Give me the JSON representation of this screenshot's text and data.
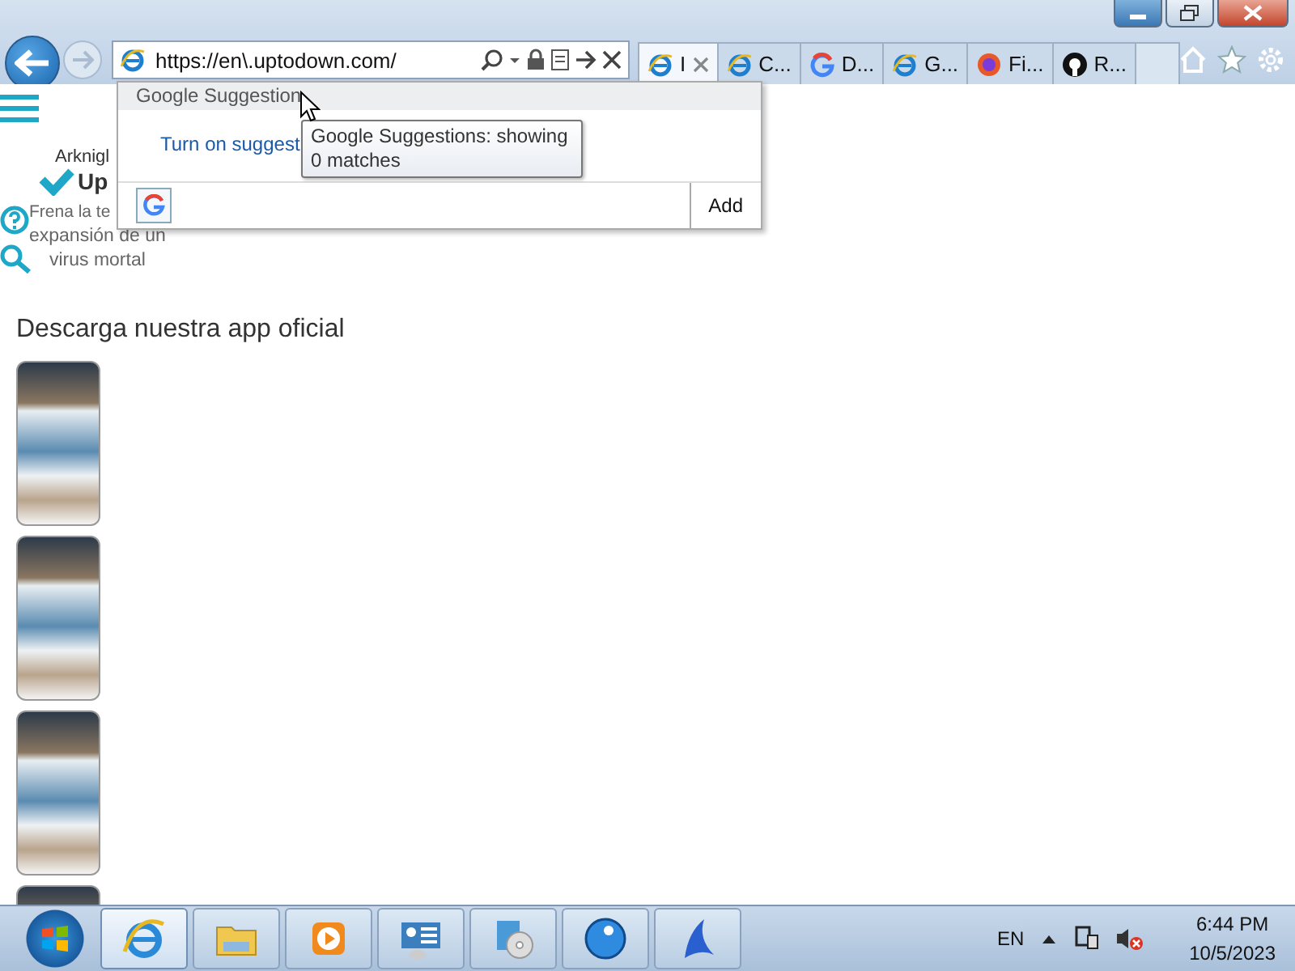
{
  "browser": {
    "address": "https://en\\.uptodown.com/",
    "tabs": [
      {
        "label": "I",
        "kind": "ie",
        "selected": true
      },
      {
        "label": "C...",
        "kind": "ie",
        "selected": false
      },
      {
        "label": "D...",
        "kind": "google",
        "selected": false
      },
      {
        "label": "G...",
        "kind": "ie",
        "selected": false
      },
      {
        "label": "Fi...",
        "kind": "firefox",
        "selected": false
      },
      {
        "label": "R...",
        "kind": "github",
        "selected": false
      }
    ]
  },
  "page": {
    "logo_text": "Up",
    "article_title": "Arknigl",
    "article_lines": [
      "Frena la te",
      "expansión de un",
      "virus mortal"
    ],
    "heading": "Descarga nuestra app oficial"
  },
  "suggestions": {
    "header": "Google Suggestion",
    "link": "Turn on suggest",
    "add_button": "Add",
    "tooltip": "Google Suggestions: showing 0 matches"
  },
  "taskbar": {
    "apps": [
      {
        "kind": "ie",
        "selected": true
      },
      {
        "kind": "folder",
        "selected": false
      },
      {
        "kind": "media",
        "selected": false
      },
      {
        "kind": "panel",
        "selected": false
      },
      {
        "kind": "installer",
        "selected": false
      },
      {
        "kind": "globe",
        "selected": false
      },
      {
        "kind": "shark",
        "selected": false
      }
    ],
    "language": "EN",
    "time": "6:44 PM",
    "date": "10/5/2023"
  }
}
